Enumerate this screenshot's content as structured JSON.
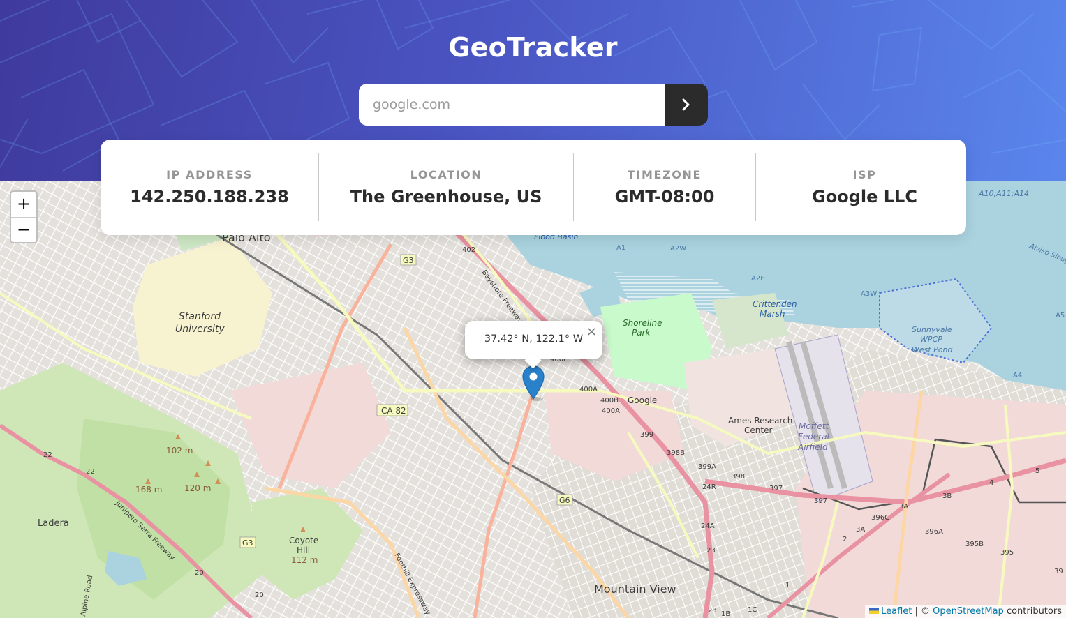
{
  "app": {
    "title": "GeoTracker"
  },
  "search": {
    "placeholder": "google.com",
    "value": ""
  },
  "search_button": {
    "icon": "chevron-right-icon"
  },
  "info": {
    "ip_label": "IP ADDRESS",
    "ip_value": "142.250.188.238",
    "location_label": "LOCATION",
    "location_value": "The Greenhouse, US",
    "timezone_label": "TIMEZONE",
    "timezone_value": "GMT-08:00",
    "isp_label": "ISP",
    "isp_value": "Google LLC"
  },
  "map": {
    "zoom_in": "+",
    "zoom_out": "−",
    "popup_text": "37.42° N, 122.1° W",
    "popup_close": "×",
    "attribution_leaflet": "Leaflet",
    "attribution_sep": " | © ",
    "attribution_osm": "OpenStreetMap",
    "attribution_tail": " contributors",
    "labels": {
      "palo_alto": "Palo Alto",
      "stanford_1": "Stanford",
      "stanford_2": "University",
      "shoreline_1": "Shoreline",
      "shoreline_2": "Park",
      "crittenden_1": "Crittenden",
      "crittenden_2": "Marsh",
      "google": "Google",
      "ames_1": "Ames Research",
      "ames_2": "Center",
      "moffett_1": "Moffett",
      "moffett_2": "Federal",
      "moffett_3": "Airfield",
      "sunnyvale_1": "Sunnyvale",
      "sunnyvale_2": "WPCP",
      "sunnyvale_3": "West Pond",
      "mountain_view": "Mountain View",
      "ladera": "Ladera",
      "coyote_1": "Coyote",
      "coyote_2": "Hill",
      "coyote_3": "112 m",
      "peak_102": "102 m",
      "peak_168": "168 m",
      "peak_120": "120 m",
      "flood_basin": "Flood Basin",
      "bayshore": "Bayshore Freeway",
      "junipero": "Junipero Serra Freeway",
      "foothill": "Foothill Expressway",
      "alpine": "Alpine Road",
      "ca82": "CA 82",
      "g3_top": "G3",
      "g3_bottom": "G3",
      "g6": "G6",
      "r400a": "400A",
      "r400b": "400B",
      "r400a2": "400A",
      "r400c": "400C",
      "r399": "399",
      "r398b": "398B",
      "r399a": "399A",
      "r24r": "24R",
      "r398": "398",
      "r397": "397",
      "r397b": "397",
      "r24a": "24A",
      "r23": "23",
      "r3a": "3A",
      "r3b": "3B",
      "r396c": "396C",
      "r3a2": "3A",
      "r2": "2",
      "r396a": "396A",
      "r395b": "395B",
      "r395": "395",
      "r4": "4",
      "r5": "5",
      "r402": "402",
      "r22a": "22",
      "r22b": "22",
      "r20a": "20",
      "r20b": "20",
      "a1": "A1",
      "a2w": "A2W",
      "a2e": "A2E",
      "a3w": "A3W",
      "a4": "A4",
      "a5": "A5",
      "a10": "A10;A11;A14",
      "alviso": "Alviso Slough",
      "r1c": "1C",
      "r23b": "23",
      "r1b": "1B",
      "r1": "1",
      "r39": "39"
    }
  },
  "colors": {
    "header_start": "#3f3a9d",
    "header_end": "#5a86ec",
    "button_dark": "#2b2b2b",
    "marker_blue": "#2a81cb",
    "water": "#aad3df",
    "park": "#c8facc",
    "residential_pink": "#f2dad9",
    "motorway": "#e892a2",
    "trunk": "#f9b29c"
  }
}
